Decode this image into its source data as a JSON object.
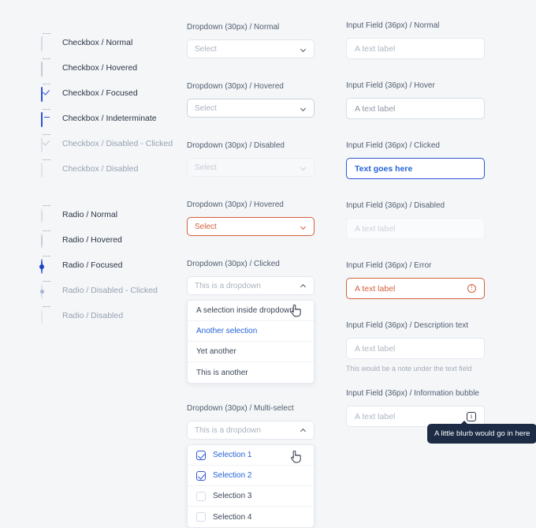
{
  "checkboxes": [
    {
      "label": "Checkbox / Normal",
      "state": "normal"
    },
    {
      "label": "Checkbox / Hovered",
      "state": "hovered"
    },
    {
      "label": "Checkbox / Focused",
      "state": "focused"
    },
    {
      "label": "Checkbox / Indeterminate",
      "state": "indeterminate"
    },
    {
      "label": "Checkbox / Disabled - Clicked",
      "state": "disabled-clicked"
    },
    {
      "label": "Checkbox / Disabled",
      "state": "disabled"
    }
  ],
  "radios": [
    {
      "label": "Radio / Normal",
      "state": "normal"
    },
    {
      "label": "Radio / Hovered",
      "state": "hovered"
    },
    {
      "label": "Radio / Focused",
      "state": "focused"
    },
    {
      "label": "Radio / Disabled - Clicked",
      "state": "disabled-clicked"
    },
    {
      "label": "Radio / Disabled",
      "state": "disabled"
    }
  ],
  "dropdowns": {
    "normal": {
      "label": "Dropdown (30px) / Normal",
      "value": "Select"
    },
    "hovered": {
      "label": "Dropdown (30px) / Hovered",
      "value": "Select"
    },
    "disabled": {
      "label": "Dropdown (30px) / Disabled",
      "value": "Select"
    },
    "error": {
      "label": "Dropdown (30px) / Hovered",
      "value": "Select"
    },
    "clicked": {
      "label": "Dropdown (30px) / Clicked",
      "value": "This is a dropdown",
      "options": [
        {
          "text": "A selection inside dropdown",
          "active": false
        },
        {
          "text": "Another selection",
          "active": true
        },
        {
          "text": "Yet another",
          "active": false
        },
        {
          "text": "This is another",
          "active": false
        }
      ]
    },
    "multi": {
      "label": "Dropdown (30px) / Multi-select",
      "value": "This is a dropdown",
      "options": [
        {
          "text": "Selection 1",
          "checked": true
        },
        {
          "text": "Selection 2",
          "checked": true
        },
        {
          "text": "Selection 3",
          "checked": false
        },
        {
          "text": "Selection 4",
          "checked": false
        }
      ]
    }
  },
  "inputs": {
    "normal": {
      "label": "Input Field (36px) / Normal",
      "value": "A text label"
    },
    "hover": {
      "label": "Input Field (36px) / Hover",
      "value": "A text label"
    },
    "clicked": {
      "label": "Input Field (36px) / Clicked",
      "value": "Text goes here"
    },
    "disabled": {
      "label": "Input Field (36px) / Disabled",
      "value": "A text label"
    },
    "error": {
      "label": "Input Field (36px) / Error",
      "value": "A text label"
    },
    "description": {
      "label": "Input Field (36px) / Description text",
      "value": "A text label",
      "note": "This would be a note under the text field"
    },
    "info": {
      "label": "Input Field (36px) / Information bubble",
      "value": "A text label",
      "tooltip": "A little blurb would go in here"
    }
  },
  "colors": {
    "background": "#f4f6f8",
    "accent_blue": "#2f54d4",
    "link_blue": "#2563d9",
    "error_orange": "#d4603c",
    "tooltip_bg": "#1d2b44",
    "text": "#2b3445",
    "muted": "#98a2b3"
  }
}
